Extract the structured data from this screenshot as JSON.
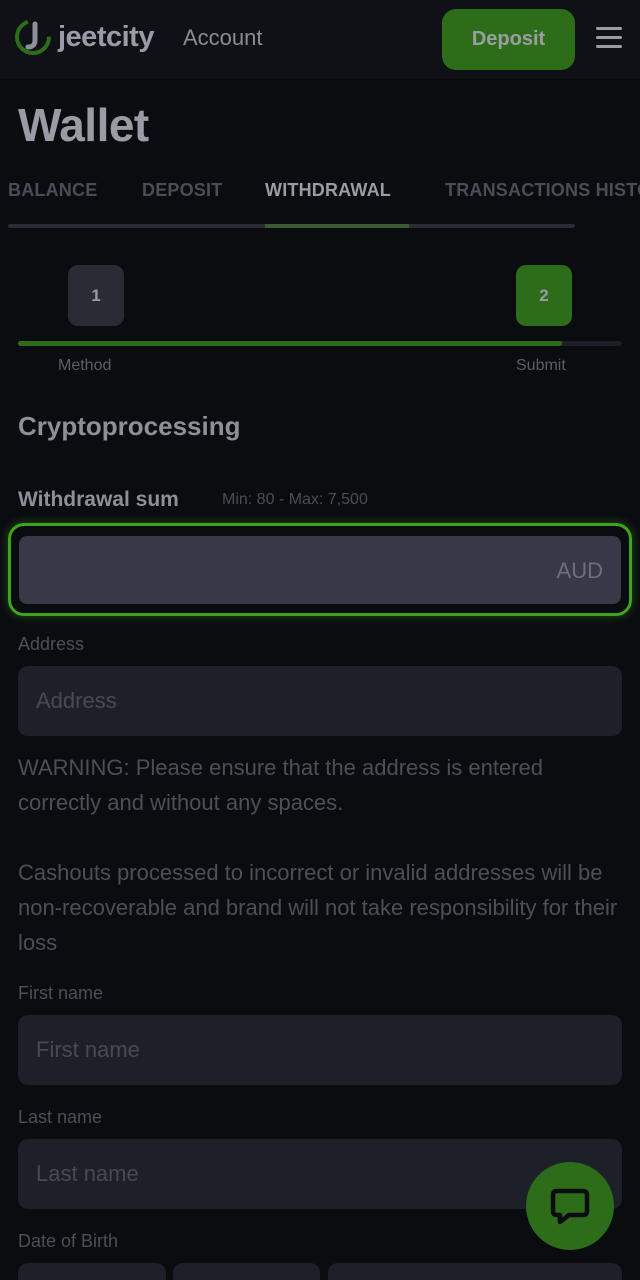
{
  "header": {
    "logo_text": "jeetcity",
    "account_label": "Account",
    "deposit_label": "Deposit"
  },
  "page": {
    "title": "Wallet"
  },
  "tabs": [
    {
      "label": "BALANCE",
      "active": false
    },
    {
      "label": "DEPOSIT",
      "active": false
    },
    {
      "label": "WITHDRAWAL",
      "active": true
    },
    {
      "label": "TRANSACTIONS HISTORY",
      "active": false
    }
  ],
  "stepper": {
    "steps": [
      {
        "number": "1",
        "label": "Method"
      },
      {
        "number": "2",
        "label": "Submit"
      }
    ],
    "current_step": 2,
    "progress_fraction": 0.9
  },
  "form": {
    "section_title": "Cryptoprocessing",
    "sum": {
      "label": "Withdrawal sum",
      "limits": "Min: 80 - Max: 7,500",
      "value": "",
      "currency": "AUD"
    },
    "address": {
      "label": "Address",
      "placeholder": "Address",
      "value": ""
    },
    "warning_1": "WARNING: Please ensure that the address is entered correctly and without any spaces.",
    "warning_2": "Cashouts processed to incorrect or invalid addresses will be non-recoverable and brand will not take responsibility for their loss",
    "first_name": {
      "label": "First name",
      "placeholder": "First name",
      "value": ""
    },
    "last_name": {
      "label": "Last name",
      "placeholder": "Last name",
      "value": ""
    },
    "dob": {
      "label": "Date of Birth"
    }
  },
  "colors": {
    "accent": "#2d6c19",
    "focus_ring": "#3ea51b",
    "background": "#0b0c10"
  },
  "icons": {
    "logo": "jeetcity-logo-icon",
    "menu": "hamburger-menu-icon",
    "chat": "chat-bubble-icon"
  }
}
